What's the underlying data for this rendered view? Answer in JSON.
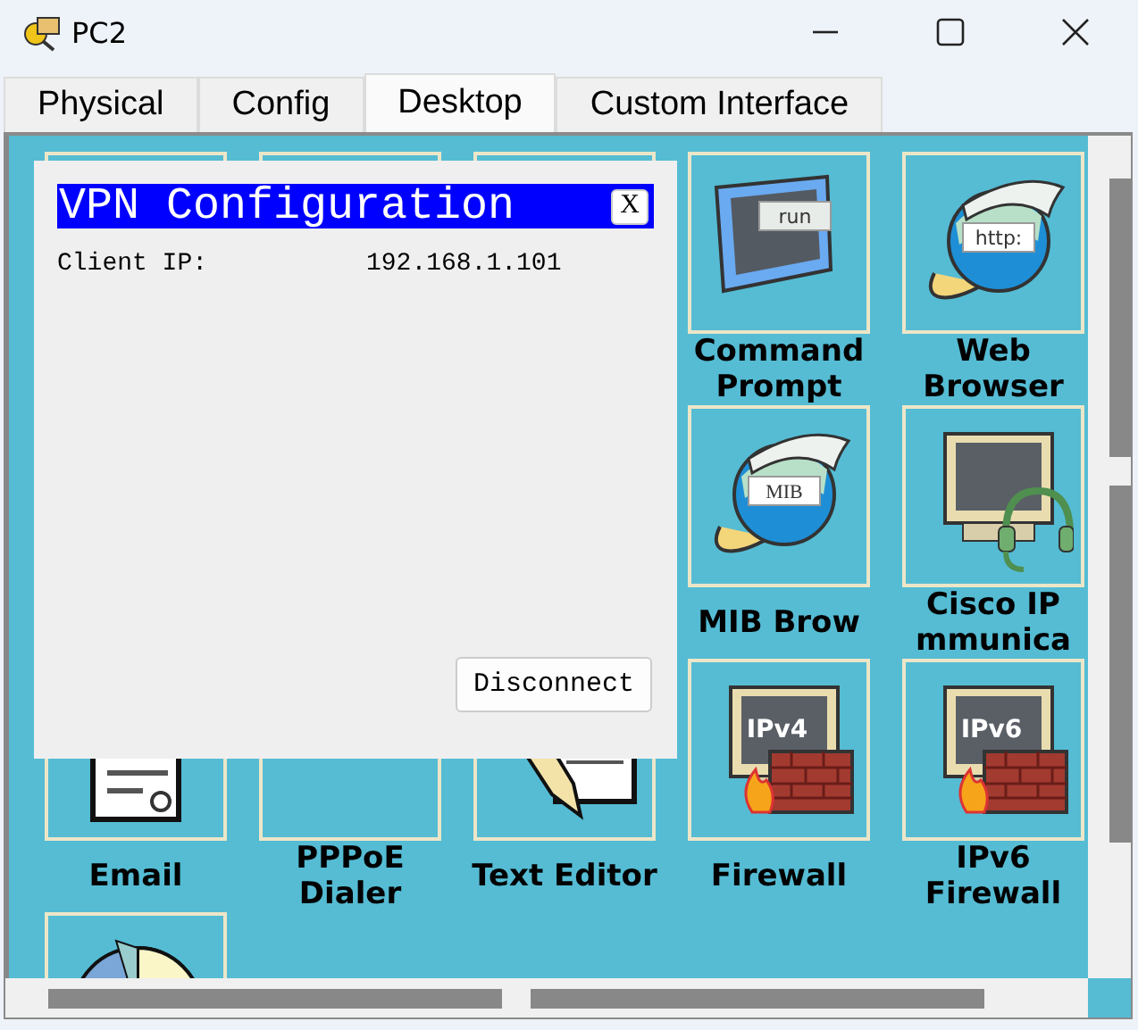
{
  "window": {
    "title": "PC2"
  },
  "tabs": [
    {
      "label": "Physical",
      "selected": false
    },
    {
      "label": "Config",
      "selected": false
    },
    {
      "label": "Desktop",
      "selected": true
    },
    {
      "label": "Custom Interface",
      "selected": false
    }
  ],
  "desktop": {
    "apps": [
      {
        "kind": "hidden"
      },
      {
        "kind": "hidden"
      },
      {
        "kind": "hidden"
      },
      {
        "kind": "terminal",
        "label": "Command Prompt",
        "badge": "run"
      },
      {
        "kind": "browser",
        "label": "Web Browser",
        "badge": "http:"
      },
      {
        "kind": "covered"
      },
      {
        "kind": "covered"
      },
      {
        "kind": "covered"
      },
      {
        "kind": "browser",
        "label": "MIB Brow",
        "badge": "MIB"
      },
      {
        "kind": "headset",
        "label": "Cisco IP mmunica"
      },
      {
        "kind": "mail",
        "label": "Email"
      },
      {
        "kind": "blank",
        "label": "PPPoE Dialer"
      },
      {
        "kind": "editor",
        "label": "Text Editor"
      },
      {
        "kind": "firewall",
        "label": "Firewall",
        "badge": "IPv4"
      },
      {
        "kind": "firewall",
        "label": "IPv6 Firewall",
        "badge": "IPv6"
      },
      {
        "kind": "pie"
      }
    ]
  },
  "dialog": {
    "title": "VPN Configuration",
    "close": "X",
    "fields": [
      {
        "label": "Client IP:",
        "value": "192.168.1.101"
      }
    ],
    "button": "Disconnect"
  }
}
